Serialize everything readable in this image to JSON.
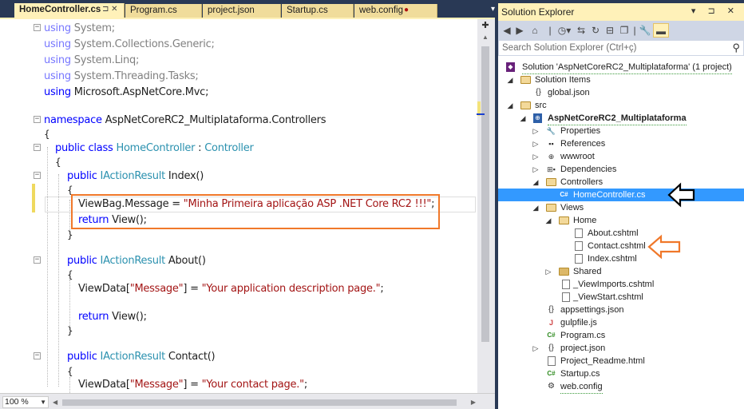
{
  "tabs": [
    {
      "label": "HomeController.cs",
      "active": true,
      "icons": "⊐ ✕"
    },
    {
      "label": "Program.cs",
      "active": false
    },
    {
      "label": "project.json",
      "active": false
    },
    {
      "label": "Startup.cs",
      "active": false
    },
    {
      "label": "web.config",
      "active": false,
      "modified": true
    }
  ],
  "tab_tools": "▾",
  "editor": {
    "lines": {
      "u1": [
        "using",
        " System;"
      ],
      "u2": [
        "using",
        " System.Collections.Generic;"
      ],
      "u3": [
        "using",
        " System.Linq;"
      ],
      "u4": [
        "using",
        " System.Threading.Tasks;"
      ],
      "u5": [
        "using",
        " Microsoft.AspNetCore.Mvc;"
      ],
      "ns": [
        "namespace",
        " AspNetCoreRC2_Multiplataforma.Controllers"
      ],
      "ob1": "{",
      "cls": [
        "public",
        " ",
        "class",
        " ",
        "HomeController",
        " : ",
        "Controller"
      ],
      "ob2": "{",
      "m1": [
        "public",
        " ",
        "IActionResult",
        " Index()"
      ],
      "ob3": "{",
      "vb": [
        "ViewBag.Message = ",
        "\"Minha Primeira aplicação ASP .NET Core RC2 !!!\"",
        ";"
      ],
      "ret1": [
        "return",
        " View();"
      ],
      "cb3": "}",
      "m2": [
        "public",
        " ",
        "IActionResult",
        " About()"
      ],
      "ob4": "{",
      "vd1": [
        "ViewData[",
        "\"Message\"",
        "] = ",
        "\"Your application description page.\"",
        ";"
      ],
      "ret2": [
        "return",
        " View();"
      ],
      "cb4": "}",
      "m3": [
        "public",
        " ",
        "IActionResult",
        " Contact()"
      ],
      "ob5": "{",
      "vd2": [
        "ViewData[",
        "\"Message\"",
        "] = ",
        "\"Your contact page.\"",
        ";"
      ]
    }
  },
  "status": {
    "zoom": "100 %"
  },
  "solution_explorer": {
    "title": "Solution Explorer",
    "title_tools": "▾ ⊐ ✕",
    "search_placeholder": "Search Solution Explorer (Ctrl+ç)",
    "tree": [
      {
        "label": "Solution 'AspNetCoreRC2_Multiplataforma' (1 project)"
      },
      {
        "label": "Solution Items"
      },
      {
        "label": "global.json"
      },
      {
        "label": "src"
      },
      {
        "label": "AspNetCoreRC2_Multiplataforma"
      },
      {
        "label": "Properties"
      },
      {
        "label": "References"
      },
      {
        "label": "wwwroot"
      },
      {
        "label": "Dependencies"
      },
      {
        "label": "Controllers"
      },
      {
        "label": "HomeController.cs",
        "selected": true
      },
      {
        "label": "Views"
      },
      {
        "label": "Home"
      },
      {
        "label": "About.cshtml"
      },
      {
        "label": "Contact.cshtml"
      },
      {
        "label": "Index.cshtml"
      },
      {
        "label": "Shared"
      },
      {
        "label": "_ViewImports.cshtml"
      },
      {
        "label": "_ViewStart.cshtml"
      },
      {
        "label": "appsettings.json"
      },
      {
        "label": "gulpfile.js"
      },
      {
        "label": "Program.cs"
      },
      {
        "label": "project.json"
      },
      {
        "label": "Project_Readme.html"
      },
      {
        "label": "Startup.cs"
      },
      {
        "label": "web.config"
      }
    ]
  },
  "colors": {
    "keyword": "#0000ff",
    "type": "#2b91af",
    "string": "#a31515",
    "highlight_box": "#f0782a",
    "selection": "#3399ff",
    "tab_active": "#fff1b9",
    "chrome": "#293955"
  },
  "icons": {
    "arrow_black": "hollow-left-arrow-icon",
    "arrow_orange": "hollow-left-arrow-icon"
  }
}
